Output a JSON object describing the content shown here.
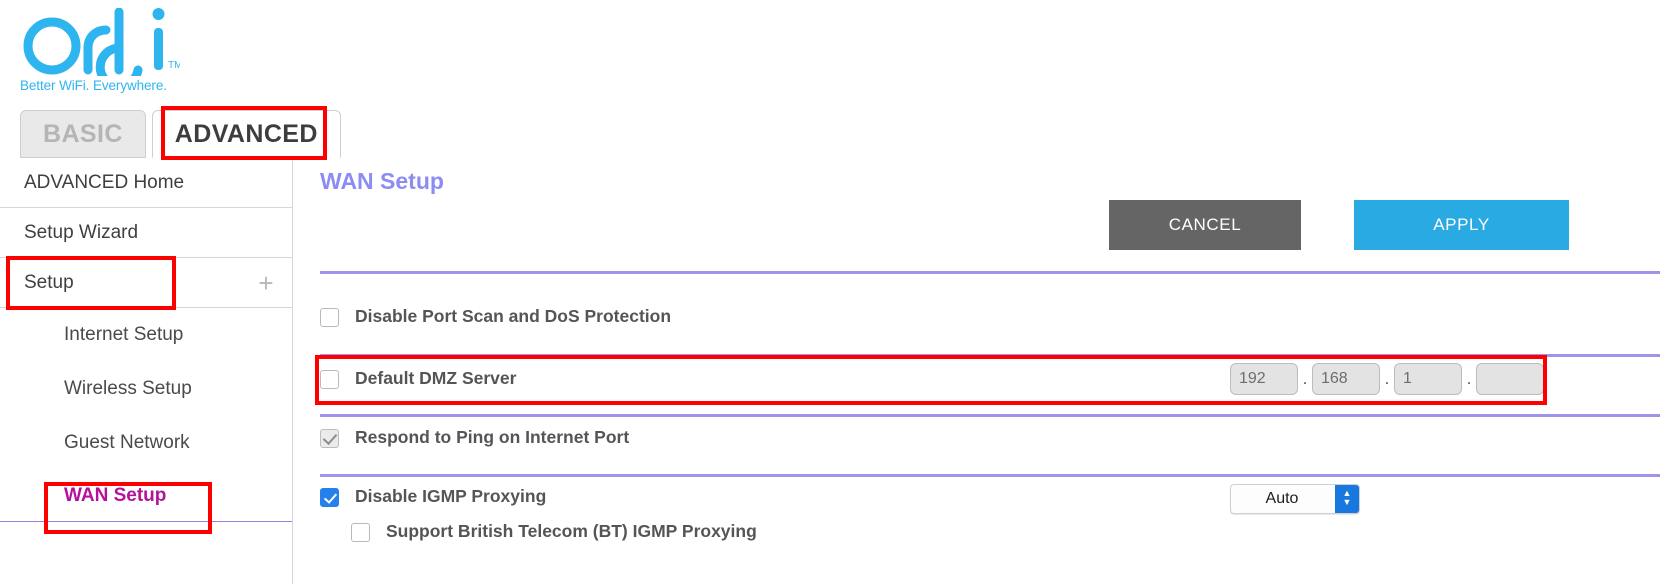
{
  "brand": {
    "logo_text": "orbi",
    "logo_tm": "TM",
    "tagline": "Better WiFi. Everywhere.",
    "logo_color": "#2eb5ef"
  },
  "tabs": [
    {
      "label": "BASIC",
      "active": false
    },
    {
      "label": "ADVANCED",
      "active": true
    }
  ],
  "sidebar": {
    "items": [
      {
        "label": "ADVANCED Home",
        "type": "top"
      },
      {
        "label": "Setup Wizard",
        "type": "top"
      },
      {
        "label": "Setup",
        "type": "top",
        "expander": "+"
      }
    ],
    "sub_items": [
      {
        "label": "Internet Setup",
        "current": false
      },
      {
        "label": "Wireless Setup",
        "current": false
      },
      {
        "label": "Guest Network",
        "current": false
      },
      {
        "label": "WAN Setup",
        "current": true
      }
    ]
  },
  "main": {
    "page_title": "WAN Setup",
    "cancel_label": "CANCEL",
    "apply_label": "APPLY",
    "accent_color": "#9d95ec",
    "apply_color": "#29aae2",
    "cancel_color": "#656565",
    "options": [
      {
        "label": "Disable Port Scan and DoS Protection",
        "state": "unchecked"
      },
      {
        "label": "Default DMZ Server",
        "state": "unchecked"
      },
      {
        "label": "Respond to Ping on Internet Port",
        "state": "disabled-checked"
      },
      {
        "label": "Disable IGMP Proxying",
        "state": "checked"
      },
      {
        "label": "Support British Telecom (BT) IGMP Proxying",
        "state": "unchecked"
      }
    ],
    "dmz_ip": {
      "octet1": "192",
      "octet2": "168",
      "octet3": "1",
      "octet4": "",
      "separator": "."
    },
    "igmp_select": {
      "value": "Auto",
      "options": [
        "Auto"
      ]
    }
  }
}
